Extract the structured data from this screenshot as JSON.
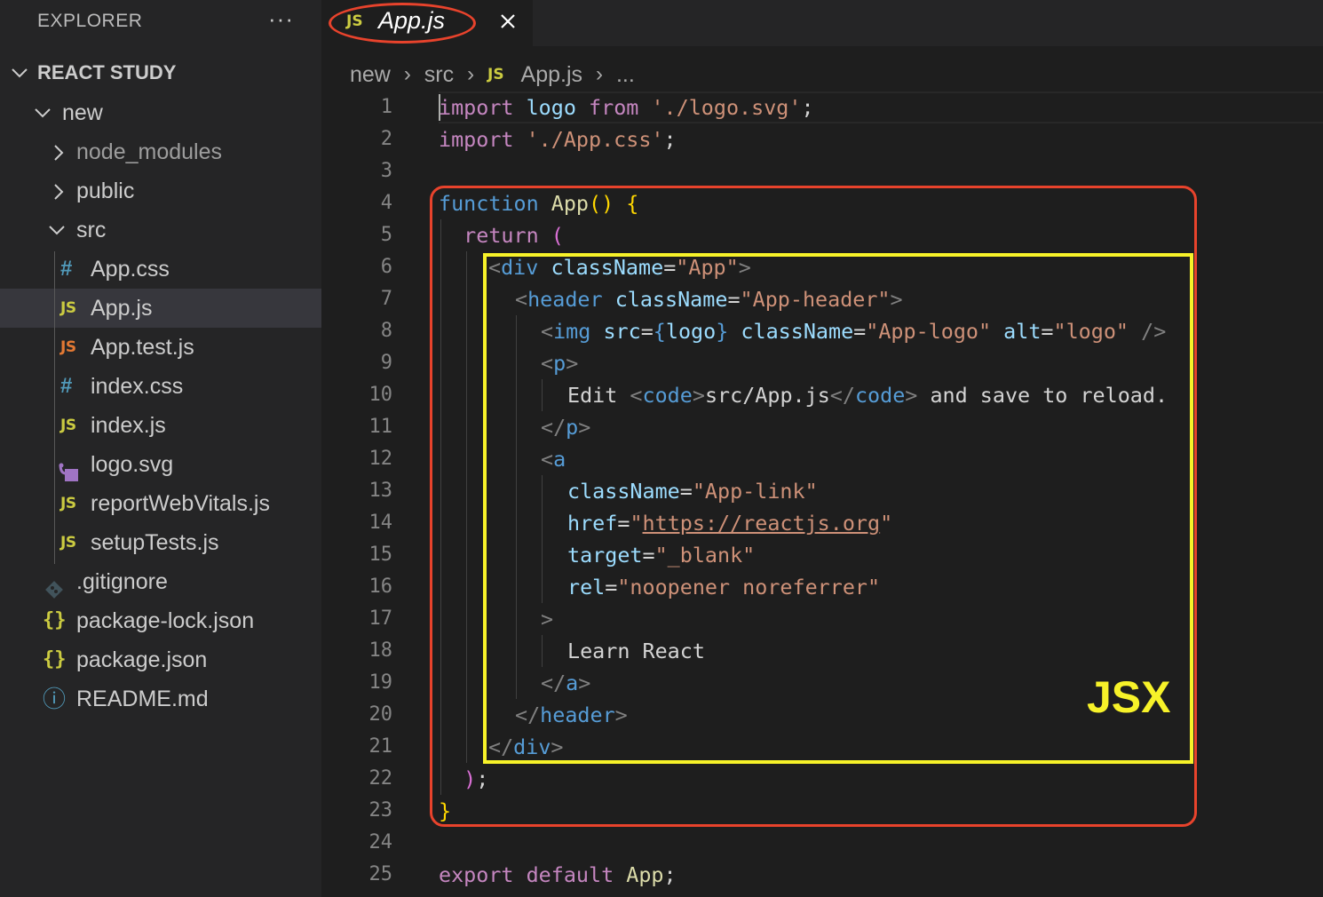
{
  "sidebar": {
    "title": "EXPLORER",
    "more": "···",
    "root": "REACT STUDY",
    "items": [
      {
        "label": "new",
        "icon": "chevron-down"
      },
      {
        "label": "node_modules",
        "icon": "chevron-right"
      },
      {
        "label": "public",
        "icon": "chevron-right"
      },
      {
        "label": "src",
        "icon": "chevron-down"
      },
      {
        "label": "App.css",
        "icon": "#"
      },
      {
        "label": "App.js",
        "icon": "JS"
      },
      {
        "label": "App.test.js",
        "icon": "JS"
      },
      {
        "label": "index.css",
        "icon": "#"
      },
      {
        "label": "index.js",
        "icon": "JS"
      },
      {
        "label": "logo.svg",
        "icon": "svg-icon"
      },
      {
        "label": "reportWebVitals.js",
        "icon": "JS"
      },
      {
        "label": "setupTests.js",
        "icon": "JS"
      },
      {
        "label": ".gitignore",
        "icon": "git-icon"
      },
      {
        "label": "package-lock.json",
        "icon": "{}"
      },
      {
        "label": "package.json",
        "icon": "{}"
      },
      {
        "label": "README.md",
        "icon": "ⓘ"
      }
    ]
  },
  "tab": {
    "badge": "JS",
    "label": "App.js",
    "close": "✕"
  },
  "breadcrumb": {
    "parts": [
      "new",
      "src",
      "App.js",
      "..."
    ],
    "badge": "JS"
  },
  "code": {
    "line_numbers": [
      "1",
      "2",
      "3",
      "4",
      "5",
      "6",
      "7",
      "8",
      "9",
      "10",
      "11",
      "12",
      "13",
      "14",
      "15",
      "16",
      "17",
      "18",
      "19",
      "20",
      "21",
      "22",
      "23",
      "24",
      "25"
    ],
    "tokens": {
      "import": "import",
      "logo": "logo",
      "from": "from",
      "logo_path": "'./logo.svg'",
      "semi": ";",
      "css_path": "'./App.css'",
      "function": "function",
      "App": "App",
      "parens": "()",
      "brace_open": "{",
      "brace_close": "}",
      "return": "return",
      "paren_open": "(",
      "paren_close": ")",
      "lt": "<",
      "gt": ">",
      "lt_slash": "</",
      "self_close": "/>",
      "div": "div",
      "header": "header",
      "img": "img",
      "p": "p",
      "a": "a",
      "code": "code",
      "className": "className",
      "src": "src",
      "alt": "alt",
      "href": "href",
      "target": "target",
      "rel": "rel",
      "eq": "=",
      "q": "\"",
      "cls_App": "\"App\"",
      "cls_header": "\"App-header\"",
      "cls_logo": "\"App-logo\"",
      "alt_logo": "\"logo\"",
      "cls_link": "\"App-link\"",
      "href_url": "https://reactjs.org",
      "target_blank": "\"_blank\"",
      "rel_val": "\"noopener noreferrer\"",
      "edit": "Edit ",
      "src_path": "src/App.js",
      "save_text": " and save to reload.",
      "learn": "Learn React",
      "export": "export",
      "default": "default"
    }
  },
  "annotation": {
    "label": "JSX"
  },
  "colors": {
    "red_box": "#e8432c",
    "yellow_box": "#f7f229"
  }
}
